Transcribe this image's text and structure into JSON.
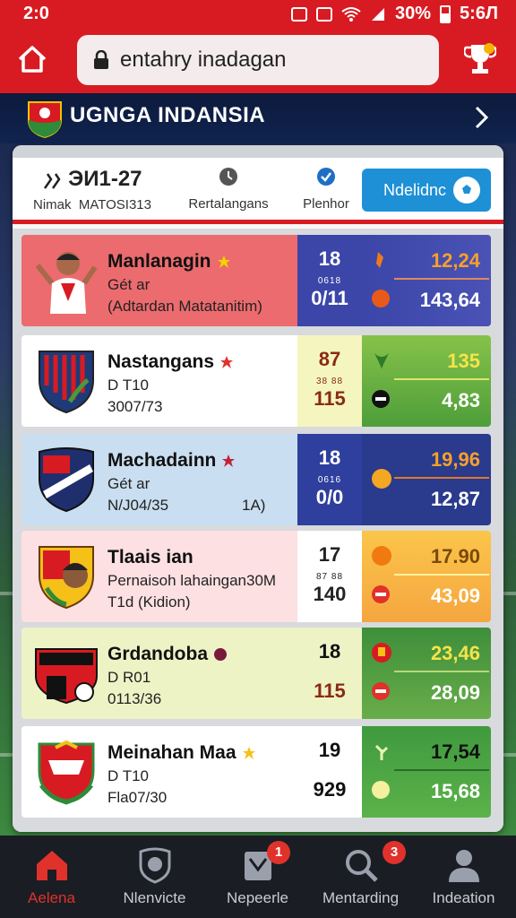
{
  "status_bar": {
    "time": "2:0",
    "battery": "30%",
    "clock": "5:6Л"
  },
  "url_bar": {
    "url": "entahry inadagan"
  },
  "title_bar": {
    "title": "UGNGA INDANSIA"
  },
  "header": {
    "col1_big": "ЭИ1-27",
    "col1_label": "Nimak",
    "col1_sub": "MATOSI313",
    "col2_label": "Rertalangans",
    "col3_label": "Plenhor",
    "nav_button": "Ndelidnc"
  },
  "colors": {
    "brand_red": "#d81b22",
    "navy": "#0c1a3c",
    "accent_blue": "#1e90d6"
  },
  "matches": [
    {
      "team": "Manlanagin",
      "line1": "Gét ar",
      "line2": "(Adtardan Matatanitim)",
      "line3": "",
      "mid_top": "18",
      "mid_small": "0618",
      "mid_bottom": "0/11",
      "odd_top": "12,24",
      "odd_bottom": "143,64"
    },
    {
      "team": "Nastangans",
      "line1": "D T10",
      "line2": "3007/73",
      "line3": "",
      "mid_top": "87",
      "mid_small": "38 88",
      "mid_bottom": "115",
      "odd_top": "135",
      "odd_bottom": "4,83"
    },
    {
      "team": "Machadainn",
      "line1": "Gét ar",
      "line2": "N/J04/35",
      "line3": "1A)",
      "mid_top": "18",
      "mid_small": "0616",
      "mid_bottom": "0/0",
      "odd_top": "19,96",
      "odd_bottom": "12,87"
    },
    {
      "team": "Tlaais ian",
      "line1": "Pernaisoh lahaingan30M",
      "line2": "T1d (Kidion)",
      "line3": "",
      "mid_top": "17",
      "mid_small": "87 88",
      "mid_bottom": "140",
      "odd_top": "17.90",
      "odd_bottom": "43,09"
    },
    {
      "team": "Grdandoba",
      "line1": "D R01",
      "line2": "0113/36",
      "line3": "",
      "mid_top": "18",
      "mid_small": "",
      "mid_bottom": "115",
      "odd_top": "23,46",
      "odd_bottom": "28,09"
    },
    {
      "team": "Meinahan Maa",
      "line1": "D T10",
      "line2": "Fla07/30",
      "line3": "",
      "mid_top": "19",
      "mid_small": "",
      "mid_bottom": "929",
      "odd_top": "17,54",
      "odd_bottom": "15,68"
    }
  ],
  "bottom_nav": [
    {
      "label": "Aelena",
      "badge": ""
    },
    {
      "label": "Nlenvicte",
      "badge": ""
    },
    {
      "label": "Nepeerle",
      "badge": "1"
    },
    {
      "label": "Mentarding",
      "badge": "3"
    },
    {
      "label": "Indeation",
      "badge": ""
    }
  ]
}
